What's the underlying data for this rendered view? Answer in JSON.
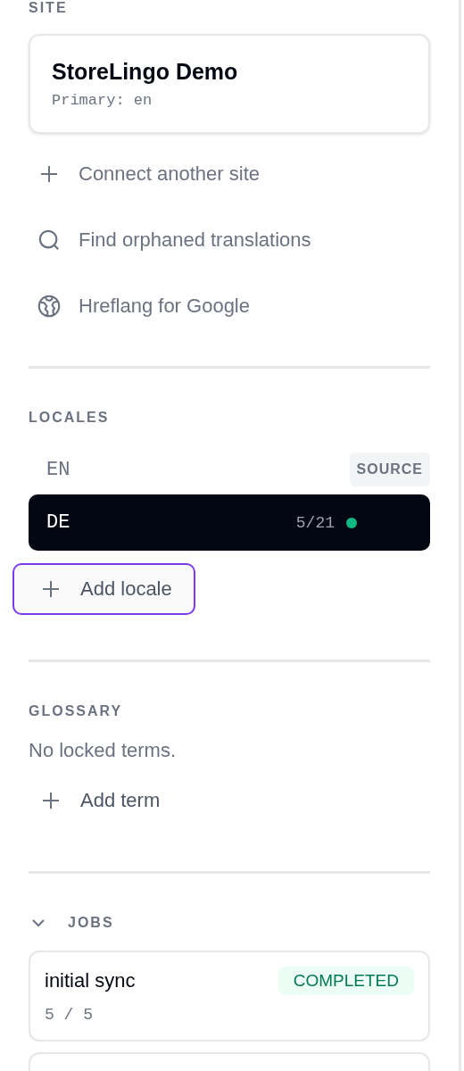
{
  "site": {
    "heading": "SITE",
    "name": "StoreLingo Demo",
    "primary": "Primary: en",
    "actions": [
      {
        "kind": "plus",
        "label": "Connect another site"
      },
      {
        "kind": "search",
        "label": "Find orphaned translations"
      },
      {
        "kind": "globe",
        "label": "Hreflang for Google"
      }
    ]
  },
  "locales": {
    "heading": "LOCALES",
    "items": [
      {
        "code": "EN",
        "badge": "SOURCE",
        "selected": false
      },
      {
        "code": "DE",
        "progress": "5/21",
        "color": "#10b981",
        "selected": true
      }
    ],
    "add_button": {
      "label": "Add locale",
      "focused": true
    }
  },
  "glossary": {
    "heading": "GLOSSARY",
    "empty_text": "No locked terms.",
    "add_button": {
      "label": "Add term"
    }
  },
  "jobs": {
    "heading": "JOBS",
    "expanded": true,
    "items": [
      {
        "name": "initial sync",
        "status": "COMPLETED",
        "kind": "completed",
        "count": "5 / 5"
      }
    ]
  }
}
